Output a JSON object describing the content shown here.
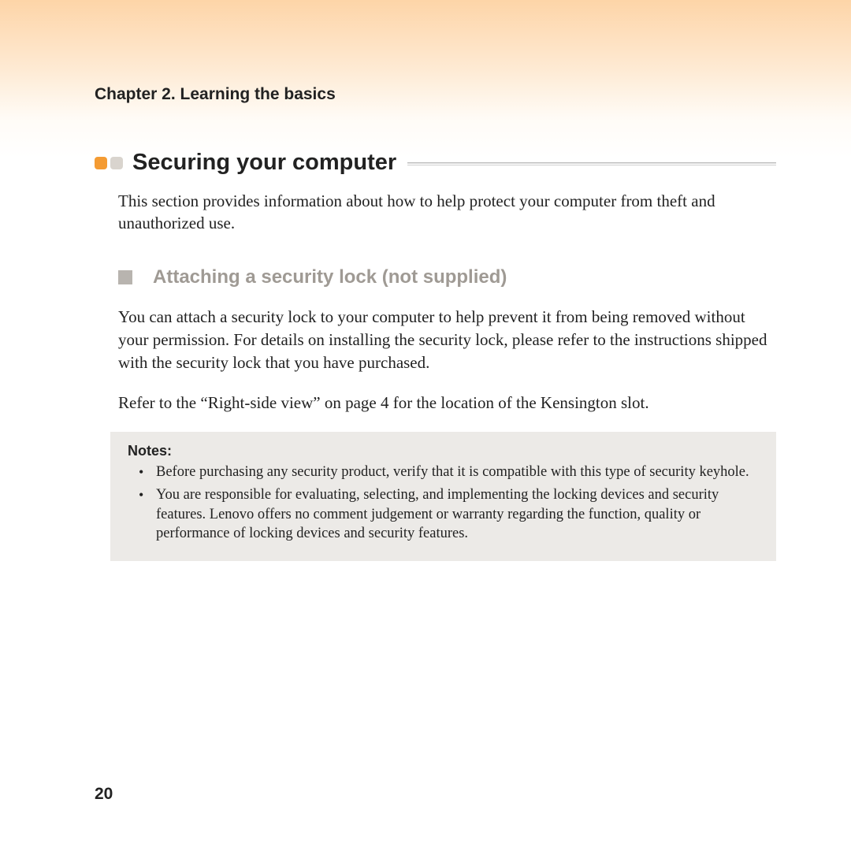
{
  "chapter_header": "Chapter 2. Learning the basics",
  "section": {
    "title": "Securing your computer",
    "intro": "This section provides information about how to help protect your computer from theft and unauthorized use."
  },
  "subsection": {
    "title": "Attaching a security lock (not supplied)",
    "paragraphs": [
      "You can attach a security lock to your computer to help prevent it from being removed without your permission. For details on installing the security lock, please refer to the instructions shipped with the security lock that you have purchased.",
      "Refer to the “Right-side view” on page 4 for the location of the Kensington slot."
    ]
  },
  "notes": {
    "label": "Notes:",
    "items": [
      "Before purchasing any security product, verify that it is compatible with this type of security keyhole.",
      "You are responsible for evaluating, selecting, and implementing the locking devices and security features. Lenovo offers no comment judgement or warranty regarding the function, quality or performance of locking devices and security features."
    ]
  },
  "page_number": "20"
}
